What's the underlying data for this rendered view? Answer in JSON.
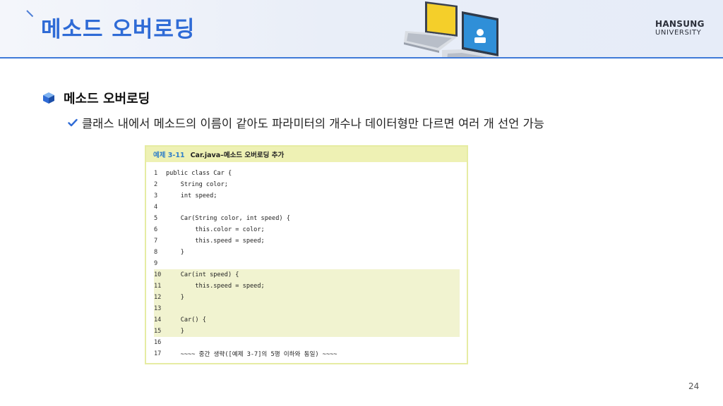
{
  "header": {
    "title": "메소드 오버로딩",
    "logo_top": "HANSUNG",
    "logo_bottom": "UNIVERSITY"
  },
  "content": {
    "heading": "메소드 오버로딩",
    "bullet": "클래스 내에서 메소드의 이름이 같아도 파라미터의 개수나 데이터형만 다르면 여러 개 선언 가능"
  },
  "example": {
    "label": "예제 3-11",
    "title": "Car.java–메소드 오버로딩 추가",
    "lines": [
      {
        "n": "1",
        "code": "public class Car {"
      },
      {
        "n": "2",
        "code": "    String color;"
      },
      {
        "n": "3",
        "code": "    int speed;"
      },
      {
        "n": "4",
        "code": ""
      },
      {
        "n": "5",
        "code": "    Car(String color, int speed) {"
      },
      {
        "n": "6",
        "code": "        this.color = color;"
      },
      {
        "n": "7",
        "code": "        this.speed = speed;"
      },
      {
        "n": "8",
        "code": "    }"
      },
      {
        "n": "9",
        "code": ""
      },
      {
        "n": "10",
        "code": "    Car(int speed) {"
      },
      {
        "n": "11",
        "code": "        this.speed = speed;"
      },
      {
        "n": "12",
        "code": "    }"
      },
      {
        "n": "13",
        "code": ""
      },
      {
        "n": "14",
        "code": "    Car() {"
      },
      {
        "n": "15",
        "code": "    }"
      },
      {
        "n": "16",
        "code": ""
      },
      {
        "n": "17",
        "code": "    ~~~~ 중간 생략([예제 3-7]의 5행 이하와 동일) ~~~~"
      }
    ]
  },
  "page_number": "24",
  "colors": {
    "title_blue": "#2f6bd6",
    "header_rule": "#3f7ad8",
    "code_highlight": "#f1f3d0",
    "code_header": "#eef1b4"
  },
  "icons": [
    "slash-accent-icon",
    "laptops-illustration",
    "cube-bullet-icon",
    "checkmark-icon"
  ]
}
